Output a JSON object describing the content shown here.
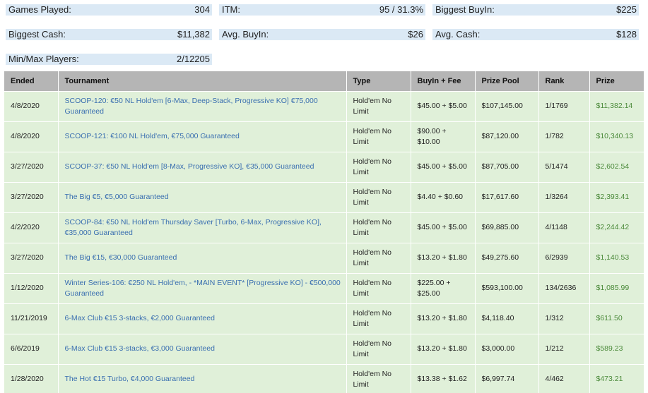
{
  "stats": {
    "games_played": {
      "label": "Games Played:",
      "value": "304"
    },
    "itm": {
      "label": "ITM:",
      "value": "95 / 31.3%"
    },
    "biggest_buyin": {
      "label": "Biggest BuyIn:",
      "value": "$225"
    },
    "biggest_cash": {
      "label": "Biggest Cash:",
      "value": "$11,382"
    },
    "avg_buyin": {
      "label": "Avg. BuyIn:",
      "value": "$26"
    },
    "avg_cash": {
      "label": "Avg. Cash:",
      "value": "$128"
    },
    "min_max_players": {
      "label": "Min/Max Players:",
      "value": "2/12205"
    }
  },
  "table": {
    "headers": [
      "Ended",
      "Tournament",
      "Type",
      "BuyIn + Fee",
      "Prize Pool",
      "Rank",
      "Prize"
    ],
    "rows": [
      {
        "ended": "4/8/2020",
        "tournament": "SCOOP-120: €50 NL Hold'em [6-Max, Deep-Stack, Progressive KO] €75,000 Guaranteed",
        "type": "Hold'em No Limit",
        "buyin": "$45.00 + $5.00",
        "pool": "$107,145.00",
        "rank": "1/1769",
        "prize": "$11,382.14"
      },
      {
        "ended": "4/8/2020",
        "tournament": "SCOOP-121: €100 NL Hold'em, €75,000 Guaranteed",
        "type": "Hold'em No Limit",
        "buyin": "$90.00 + $10.00",
        "pool": "$87,120.00",
        "rank": "1/782",
        "prize": "$10,340.13"
      },
      {
        "ended": "3/27/2020",
        "tournament": "SCOOP-37: €50 NL Hold'em [8-Max, Progressive KO], €35,000 Guaranteed",
        "type": "Hold'em No Limit",
        "buyin": "$45.00 + $5.00",
        "pool": "$87,705.00",
        "rank": "5/1474",
        "prize": "$2,602.54"
      },
      {
        "ended": "3/27/2020",
        "tournament": "The Big €5, €5,000 Guaranteed",
        "type": "Hold'em No Limit",
        "buyin": "$4.40 + $0.60",
        "pool": "$17,617.60",
        "rank": "1/3264",
        "prize": "$2,393.41"
      },
      {
        "ended": "4/2/2020",
        "tournament": "SCOOP-84: €50 NL Hold'em Thursday Saver [Turbo, 6-Max, Progressive KO], €35,000 Guaranteed",
        "type": "Hold'em No Limit",
        "buyin": "$45.00 + $5.00",
        "pool": "$69,885.00",
        "rank": "4/1148",
        "prize": "$2,244.42"
      },
      {
        "ended": "3/27/2020",
        "tournament": "The Big €15, €30,000 Guaranteed",
        "type": "Hold'em No Limit",
        "buyin": "$13.20 + $1.80",
        "pool": "$49,275.60",
        "rank": "6/2939",
        "prize": "$1,140.53"
      },
      {
        "ended": "1/12/2020",
        "tournament": "Winter Series-106: €250 NL Hold'em, - *MAIN EVENT* [Progressive KO] - €500,000 Guaranteed",
        "type": "Hold'em No Limit",
        "buyin": "$225.00 + $25.00",
        "pool": "$593,100.00",
        "rank": "134/2636",
        "prize": "$1,085.99"
      },
      {
        "ended": "11/21/2019",
        "tournament": "6-Max Club €15 3-stacks, €2,000 Guaranteed",
        "type": "Hold'em No Limit",
        "buyin": "$13.20 + $1.80",
        "pool": "$4,118.40",
        "rank": "1/312",
        "prize": "$611.50"
      },
      {
        "ended": "6/6/2019",
        "tournament": "6-Max Club €15 3-stacks, €3,000 Guaranteed",
        "type": "Hold'em No Limit",
        "buyin": "$13.20 + $1.80",
        "pool": "$3,000.00",
        "rank": "1/212",
        "prize": "$589.23"
      },
      {
        "ended": "1/28/2020",
        "tournament": "The Hot €15 Turbo, €4,000 Guaranteed",
        "type": "Hold'em No Limit",
        "buyin": "$13.38 + $1.62",
        "pool": "$6,997.74",
        "rank": "4/462",
        "prize": "$473.21"
      }
    ]
  },
  "colors": {
    "stat_bg": "#dbe9f5",
    "header_bg": "#b5b5b5",
    "row_bg": "#e0f0d9",
    "link": "#3a6fb0",
    "prize": "#4b8a3a"
  }
}
